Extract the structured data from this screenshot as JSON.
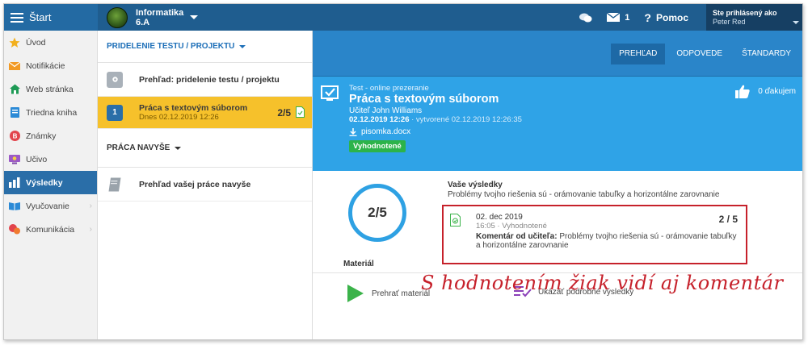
{
  "colors": {
    "topbar": "#1f5d8f",
    "active_nav": "#2a6ea8",
    "selected_item": "#f6c12b",
    "hero": "#2fa3e7",
    "badge_green": "#2cb34a",
    "annotation_red": "#c6212b"
  },
  "topbar": {
    "menu_icon": "hamburger-icon",
    "start_label": "Štart",
    "class_name": "Informatika",
    "class_section": "6.A",
    "messages_count": "1",
    "help_label": "Pomoc",
    "user_line1": "Ste prihlásený ako",
    "user_line2": "Peter Red"
  },
  "sidebar": {
    "items": [
      {
        "label": "Úvod",
        "icon": "star-icon"
      },
      {
        "label": "Notifikácie",
        "icon": "envelope-icon"
      },
      {
        "label": "Web stránka",
        "icon": "home-icon"
      },
      {
        "label": "Triedna kniha",
        "icon": "book-icon"
      },
      {
        "label": "Známky",
        "icon": "grade-icon"
      },
      {
        "label": "Učivo",
        "icon": "lesson-icon"
      },
      {
        "label": "Výsledky",
        "icon": "results-chart-icon"
      },
      {
        "label": "Vyučovanie",
        "icon": "teaching-icon"
      },
      {
        "label": "Komunikácia",
        "icon": "chat-icon"
      }
    ]
  },
  "middle": {
    "section1_title": "PRIDELENIE TESTU / PROJEKTU",
    "overview_item": "Prehľad: pridelenie testu / projektu",
    "selected_item": {
      "number": "1",
      "title": "Práca s textovým súborom",
      "subtitle": "Dnes 02.12.2019 12:26",
      "score": "2/5"
    },
    "section2_title": "PRÁCA NAVYŠE",
    "extra_item": "Prehľad vašej práce navyše"
  },
  "right": {
    "tabs": [
      "PREHĽAD",
      "ODPOVEDE",
      "ŠTANDARDY"
    ],
    "hero": {
      "kind": "Test - online prezeranie",
      "title": "Práca s textovým súborom",
      "teacher": "Učiteľ John Williams",
      "date": "02.12.2019 12:26",
      "created": " · vytvorené 02.12.2019 12:26:35",
      "file": "pisomka.docx",
      "status": "Vyhodnotené",
      "likes": "0 ďakujem"
    },
    "results": {
      "score": "2/5",
      "title": "Vaše výsledky",
      "description": "Problémy tvojho riešenia sú - orámovanie tabuľky a horizontálne zarovnanie",
      "entry_date": "02. dec 2019",
      "entry_time": "16:05 · Vyhodnotené",
      "entry_score": "2 / 5",
      "comment_label": "Komentár od učiteľa:",
      "comment_text": " Problémy tvojho riešenia sú - orámovanie tabuľky a horizontálne zarovnanie"
    },
    "material": {
      "title": "Materiál",
      "play_label": "Prehrať materiál",
      "details_label": "Ukázať podrobné výsledky"
    }
  },
  "annotation": "S hodnotením žiak vidí aj komentár"
}
